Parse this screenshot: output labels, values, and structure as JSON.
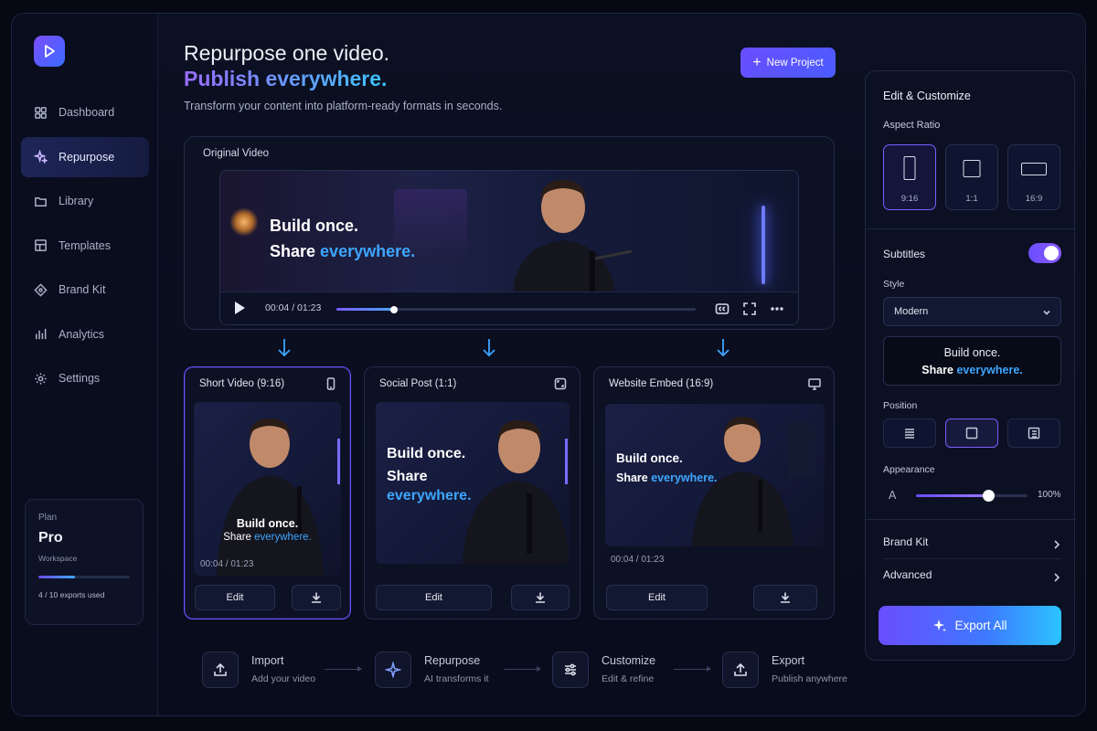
{
  "sidebar": {
    "items": [
      {
        "label": "Dashboard",
        "icon": "grid-icon"
      },
      {
        "label": "Repurpose",
        "icon": "sparkle-icon",
        "active": true
      },
      {
        "label": "Library",
        "icon": "folder-icon"
      },
      {
        "label": "Templates",
        "icon": "layout-icon"
      },
      {
        "label": "Brand Kit",
        "icon": "diamond-icon"
      },
      {
        "label": "Analytics",
        "icon": "bar-chart-icon"
      },
      {
        "label": "Settings",
        "icon": "gear-icon"
      }
    ],
    "plan": {
      "label": "Plan",
      "tier": "Pro",
      "workspace": "Workspace",
      "usage": "4 / 10 exports used",
      "used": 4,
      "total": 10
    }
  },
  "header": {
    "title_line1": "Repurpose one video.",
    "title_line2": "Publish everywhere.",
    "subtitle": "Transform your content into platform-ready formats in seconds.",
    "new_project": "New Project"
  },
  "original": {
    "title": "Original Video",
    "overlay_line1": "Build once.",
    "overlay_word": "Share",
    "overlay_accent": "everywhere.",
    "time": "00:04 / 01:23",
    "progress_fraction": 0.16
  },
  "outputs": [
    {
      "title": "Short Video (9:16)",
      "icon": "phone-icon",
      "caption1": "Build once.",
      "caption2a": "Share",
      "caption2b": "everywhere.",
      "time": "00:04 / 01:23",
      "edit": "Edit"
    },
    {
      "title": "Social Post (1:1)",
      "icon": "crop-square-icon",
      "caption1": "Build once.",
      "caption2a": "Share",
      "caption2b": "everywhere.",
      "time": "",
      "edit": "Edit"
    },
    {
      "title": "Website Embed (16:9)",
      "icon": "monitor-icon",
      "caption1": "Build once.",
      "caption2a": "Share",
      "caption2b": "everywhere.",
      "time": "00:04 / 01:23",
      "edit": "Edit"
    }
  ],
  "steps": [
    {
      "title": "Import",
      "desc": "Add your video",
      "icon": "upload-icon"
    },
    {
      "title": "Repurpose",
      "desc": "AI transforms it",
      "icon": "sparkle-icon"
    },
    {
      "title": "Customize",
      "desc": "Edit & refine",
      "icon": "sliders-icon"
    },
    {
      "title": "Export",
      "desc": "Publish anywhere",
      "icon": "upload-icon"
    }
  ],
  "panel": {
    "title": "Edit & Customize",
    "aspect_label": "Aspect Ratio",
    "aspects": [
      "9:16",
      "1:1",
      "16:9"
    ],
    "aspect_selected": "9:16",
    "subtitles_label": "Subtitles",
    "subtitles_on": true,
    "style_label": "Style",
    "style_value": "Modern",
    "preview_line1": "Build once.",
    "preview_word": "Share",
    "preview_accent": "everywhere.",
    "position_label": "Position",
    "appearance_label": "Appearance",
    "appearance_glyph": "A",
    "appearance_value": "100%",
    "appearance_fraction": 0.65,
    "brand_kit": "Brand Kit",
    "advanced": "Advanced",
    "export_all": "Export All"
  },
  "colors": {
    "accent_purple": "#6a4dff",
    "accent_blue": "#3ea6ff",
    "background": "#080c1b"
  }
}
